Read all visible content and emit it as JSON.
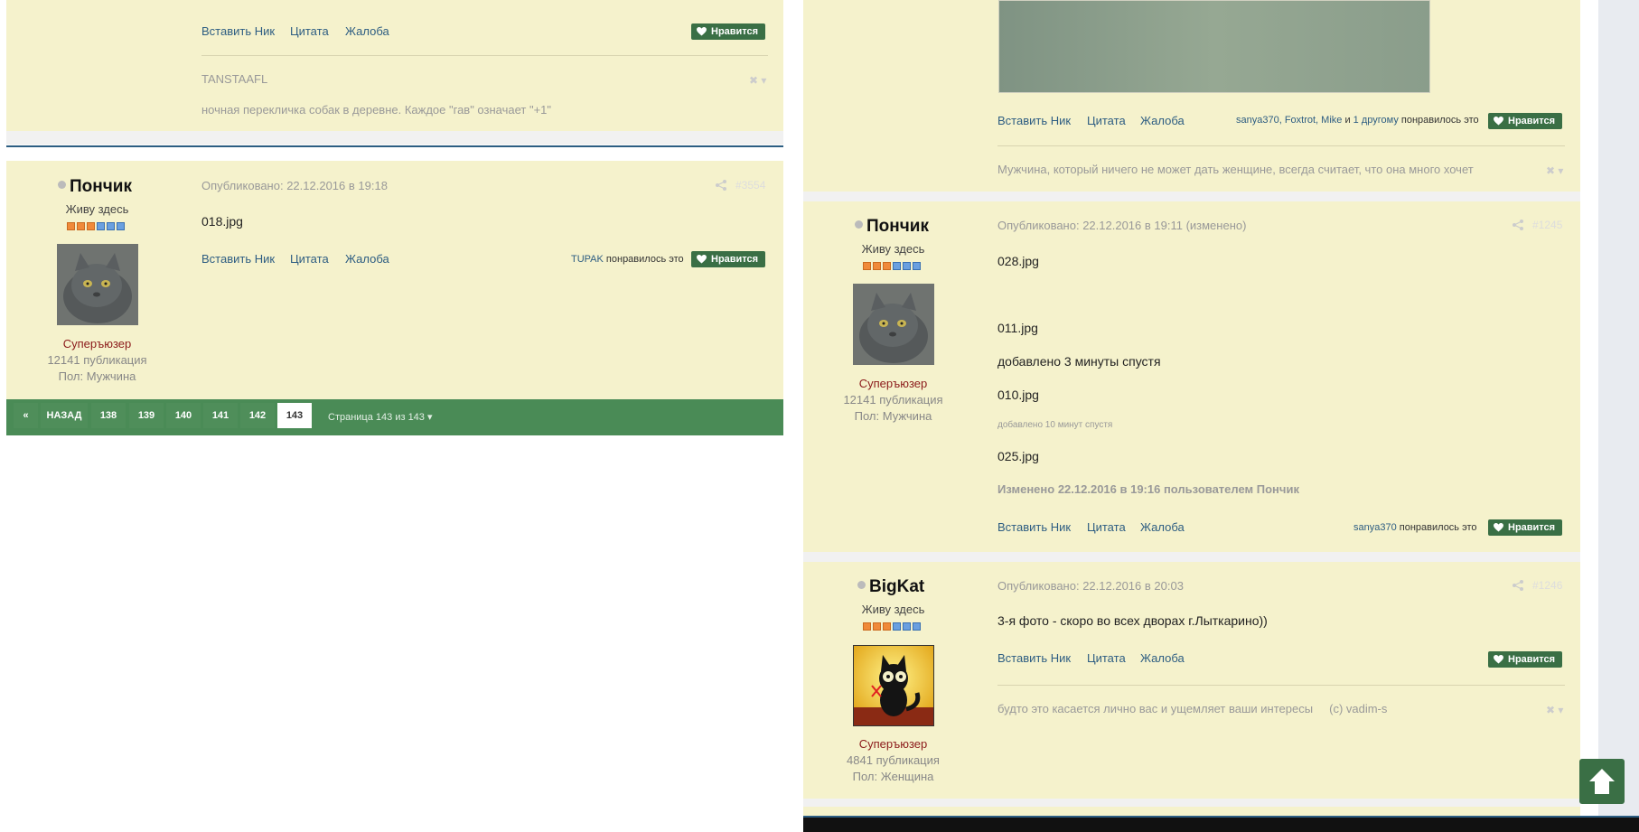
{
  "colors": {
    "post_bg": "#f5f2cc",
    "like_green": "#3a6f45",
    "pager_green": "#4a8b56",
    "link": "#2d5d82",
    "group_red": "#8b1a1a"
  },
  "actions": {
    "quote_nick": "Вставить Ник",
    "quote": "Цитата",
    "report": "Жалоба",
    "like": "Нравится"
  },
  "left": {
    "post_a": {
      "signature_title": "TANSTAAFL",
      "signature_text": "ночная перекличка собак в деревне. Каждое \"гав\" означает \"+1\""
    },
    "post_b": {
      "author": "Пончик",
      "rank": "Живу здесь",
      "group": "Суперъюзер",
      "posts": "12141 публикация",
      "gender": "Пол: Мужчина",
      "published": "Опубликовано: 22.12.2016 в 19:18",
      "post_number": "#3554",
      "attachment": "018.jpg",
      "liked_by_user": "TUPAK",
      "liked_suffix": " понравилось это"
    },
    "pagination": {
      "back": "НАЗАД",
      "pages": [
        "138",
        "139",
        "140",
        "141",
        "142",
        "143"
      ],
      "current": "143",
      "summary": "Страница 143 из 143"
    }
  },
  "right": {
    "post_a": {
      "liked_users": "sanya370, Foxtrot, Mike",
      "liked_and": " и ",
      "liked_more": "1 другому",
      "liked_suffix": " понравилось это",
      "signature_text": "Мужчина, который ничего не может дать женщине, всегда считает, что она много хочет"
    },
    "post_b": {
      "author": "Пончик",
      "rank": "Живу здесь",
      "group": "Суперъюзер",
      "posts": "12141 публикация",
      "gender": "Пол: Мужчина",
      "published": "Опубликовано: 22.12.2016 в 19:11 (изменено)",
      "post_number": "#1245",
      "file1": "028.jpg",
      "file2": "011.jpg",
      "added1": "добавлено 3 минуты спустя",
      "file3": "010.jpg",
      "added2": "добавлено 10 минут спустя",
      "file4": "025.jpg",
      "edited": "Изменено 22.12.2016 в 19:16 пользователем Пончик",
      "liked_user": "sanya370",
      "liked_suffix": " понравилось это"
    },
    "post_c": {
      "author": "BigKat",
      "rank": "Живу здесь",
      "group": "Суперъюзер",
      "posts": "4841 публикация",
      "gender": "Пол: Женщина",
      "published": "Опубликовано: 22.12.2016 в 20:03",
      "post_number": "#1246",
      "text": "3-я фото - скоро во всех дворах г.Лыткарино))",
      "signature_text": "будто это касается лично вас и ущемляет ваши интересы     (c) vadim-s"
    }
  },
  "icons": {
    "like": "heart-icon",
    "share": "share-icon",
    "scroll_top": "arrow-up-icon",
    "collapse": "close-icon",
    "first_page": "double-chevron-left-icon"
  }
}
